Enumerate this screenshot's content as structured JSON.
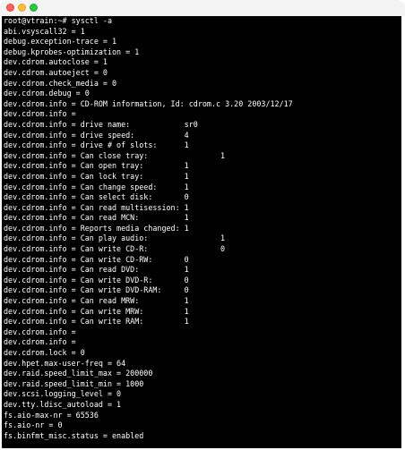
{
  "window": {
    "buttons": [
      "close",
      "minimize",
      "zoom"
    ]
  },
  "terminal": {
    "lines": [
      "root@vtrain:~# sysctl -a",
      "abi.vsyscall32 = 1",
      "debug.exception-trace = 1",
      "debug.kprobes-optimization = 1",
      "dev.cdrom.autoclose = 1",
      "dev.cdrom.autoeject = 0",
      "dev.cdrom.check_media = 0",
      "dev.cdrom.debug = 0",
      "dev.cdrom.info = CD-ROM information, Id: cdrom.c 3.20 2003/12/17",
      "dev.cdrom.info =",
      "dev.cdrom.info = drive name:            sr0",
      "dev.cdrom.info = drive speed:           4",
      "dev.cdrom.info = drive # of slots:      1",
      "dev.cdrom.info = Can close tray:                1",
      "dev.cdrom.info = Can open tray:         1",
      "dev.cdrom.info = Can lock tray:         1",
      "dev.cdrom.info = Can change speed:      1",
      "dev.cdrom.info = Can select disk:       0",
      "dev.cdrom.info = Can read multisession: 1",
      "dev.cdrom.info = Can read MCN:          1",
      "dev.cdrom.info = Reports media changed: 1",
      "dev.cdrom.info = Can play audio:                1",
      "dev.cdrom.info = Can write CD-R:                0",
      "dev.cdrom.info = Can write CD-RW:       0",
      "dev.cdrom.info = Can read DVD:          1",
      "dev.cdrom.info = Can write DVD-R:       0",
      "dev.cdrom.info = Can write DVD-RAM:     0",
      "dev.cdrom.info = Can read MRW:          1",
      "dev.cdrom.info = Can write MRW:         1",
      "dev.cdrom.info = Can write RAM:         1",
      "dev.cdrom.info =",
      "dev.cdrom.info =",
      "dev.cdrom.lock = 0",
      "dev.hpet.max-user-freq = 64",
      "dev.raid.speed_limit_max = 200000",
      "dev.raid.speed_limit_min = 1000",
      "dev.scsi.logging_level = 0",
      "dev.tty.ldisc_autoload = 1",
      "fs.aio-max-nr = 65536",
      "fs.aio-nr = 0",
      "fs.binfmt_misc.status = enabled"
    ]
  }
}
